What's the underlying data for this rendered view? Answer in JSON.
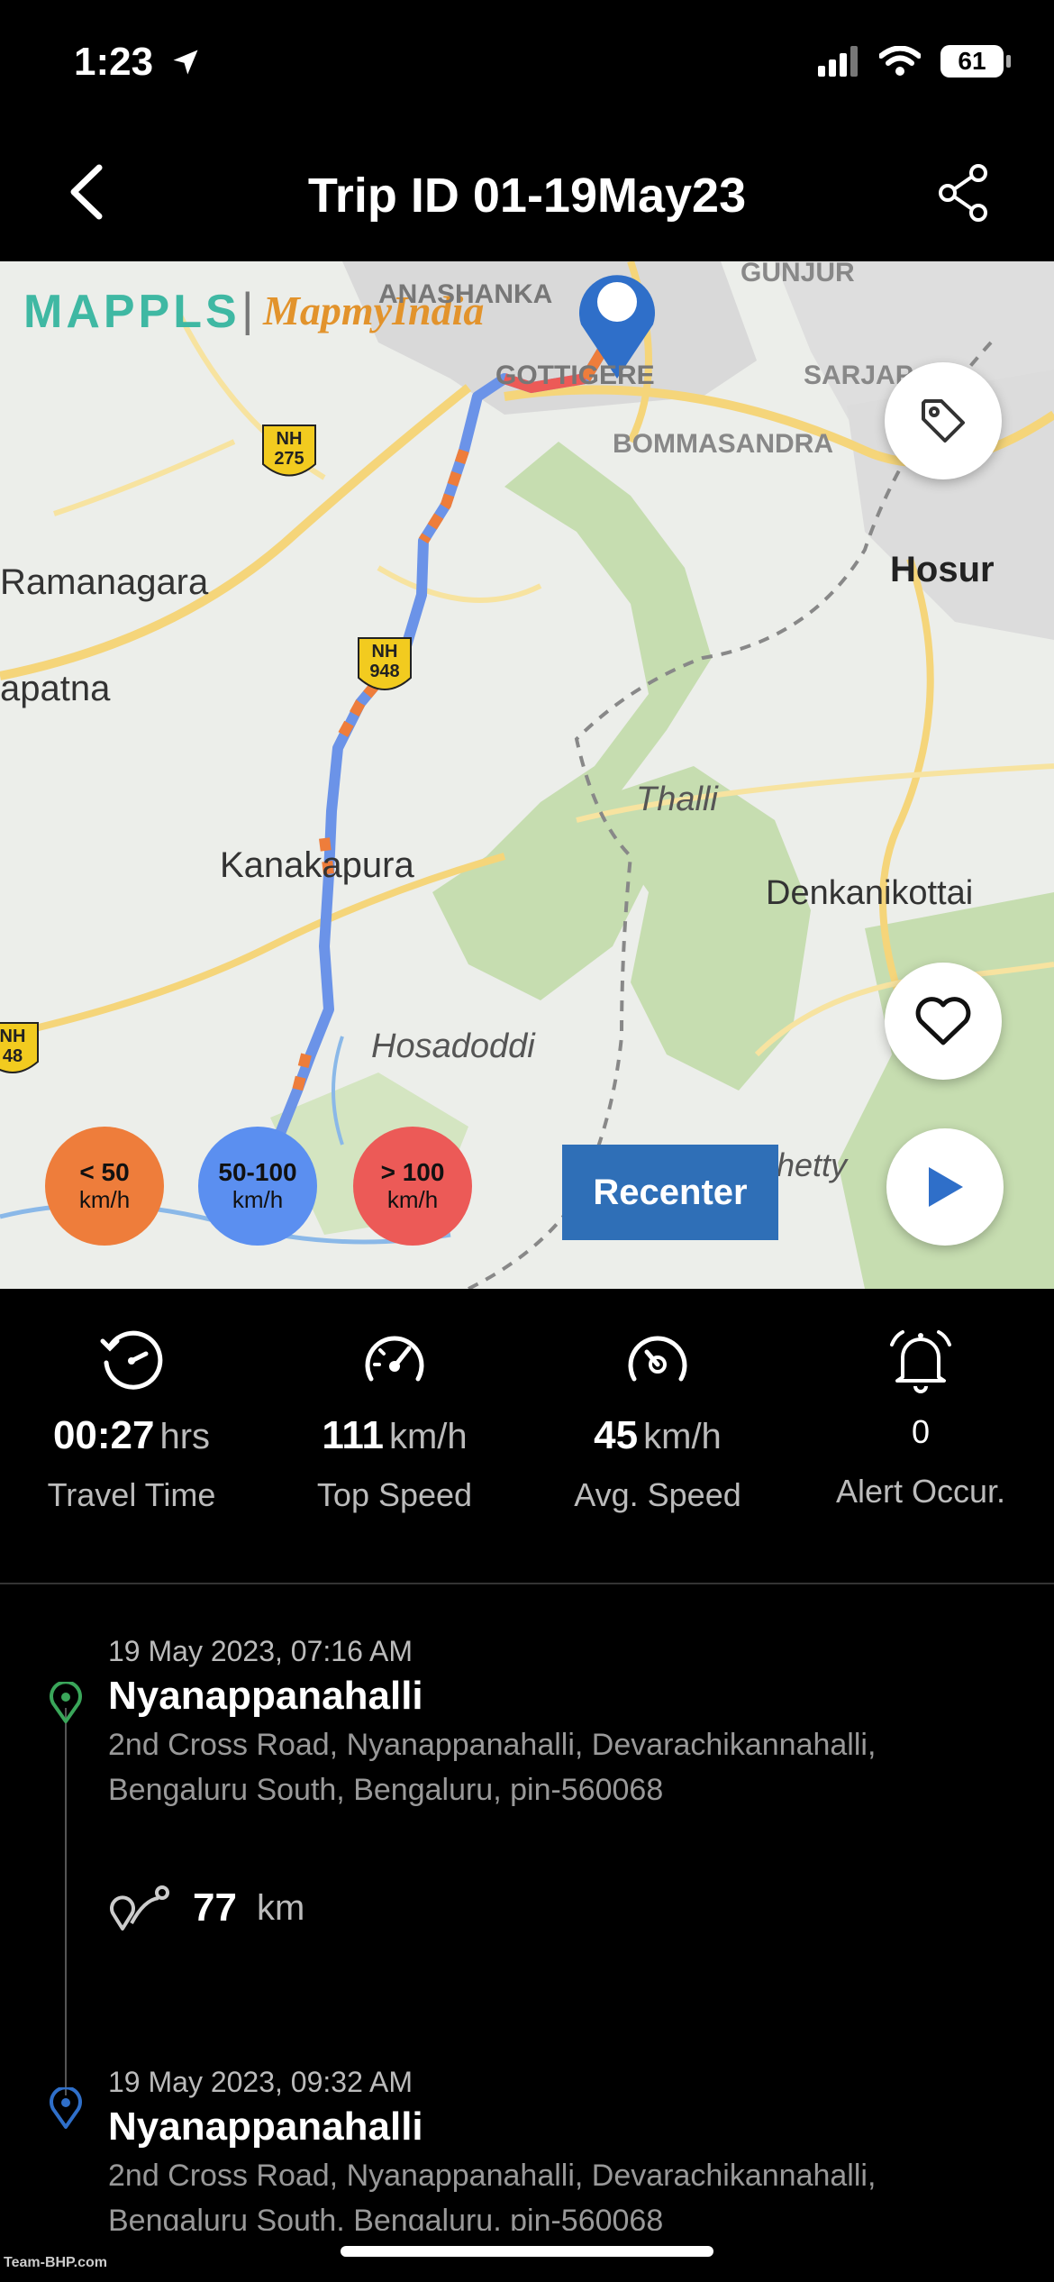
{
  "status_bar": {
    "time": "1:23",
    "battery": "61"
  },
  "header": {
    "title": "Trip ID 01-19May23"
  },
  "map": {
    "brand_left": "MAPPLS",
    "brand_right": "MapmyIndia",
    "places": {
      "anashanka": "ANASHANKA",
      "gunjur": "GUNJUR",
      "gottigere": "GOTTIGERE",
      "sarjap": "SARJAP",
      "bommasandra": "BOMMASANDRA",
      "hosur": "Hosur",
      "ramanagara": "Ramanagara",
      "apatna": "apatna",
      "thalli": "Thalli",
      "kanakapura": "Kanakapura",
      "denkanikottai": "Denkanikottai",
      "hosadoddi": "Hosadoddi",
      "hetty": "hetty"
    },
    "highway_shields": {
      "nh275": [
        "NH",
        "275"
      ],
      "nh948": [
        "NH",
        "948"
      ],
      "nh48": [
        "NH",
        "48"
      ]
    },
    "legend": [
      {
        "label": "< 50",
        "unit": "km/h",
        "color": "#ee7d3b"
      },
      {
        "label": "50-100",
        "unit": "km/h",
        "color": "#5b8ff0"
      },
      {
        "label": "> 100",
        "unit": "km/h",
        "color": "#ec5a57"
      }
    ],
    "recenter_label": "Recenter"
  },
  "stats": [
    {
      "value": "00:27",
      "unit": "hrs",
      "label": "Travel Time",
      "icon": "clock-icon"
    },
    {
      "value": "111",
      "unit": "km/h",
      "label": "Top Speed",
      "icon": "speedometer-icon"
    },
    {
      "value": "45",
      "unit": "km/h",
      "label": "Avg. Speed",
      "icon": "gauge-icon"
    },
    {
      "value": "0",
      "unit": "",
      "label": "Alert Occur.",
      "icon": "bell-icon"
    }
  ],
  "trip": {
    "start": {
      "datetime": "19 May 2023, 07:16 AM",
      "name": "Nyanappanahalli",
      "address": "2nd Cross Road, Nyanappanahalli, Devarachikannahalli, Bengaluru South, Bengaluru, pin-560068"
    },
    "distance": {
      "value": "77",
      "unit": "km"
    },
    "end": {
      "datetime": "19 May 2023, 09:32 AM",
      "name": "Nyanappanahalli",
      "address": "2nd Cross Road, Nyanappanahalli, Devarachikannahalli, Bengaluru South, Bengaluru, pin-560068"
    }
  },
  "watermark": "Team-BHP.com"
}
